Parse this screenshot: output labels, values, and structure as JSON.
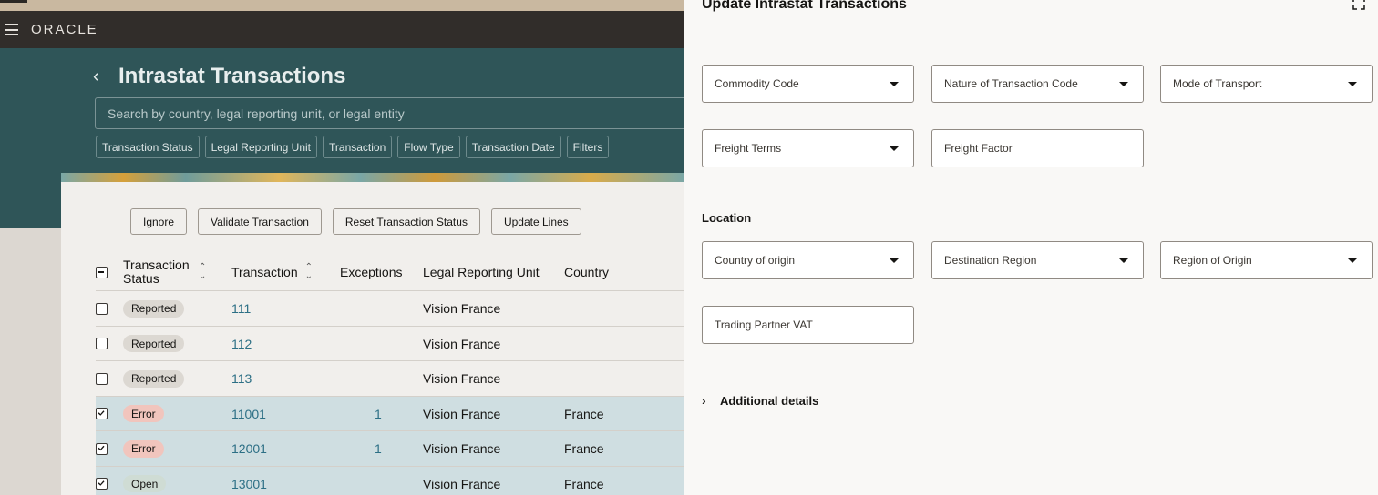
{
  "header": {
    "logo": "ORACLE"
  },
  "page": {
    "title": "Intrastat Transactions",
    "search_placeholder": "Search by country, legal reporting unit, or legal entity"
  },
  "filters": [
    "Transaction Status",
    "Legal Reporting Unit",
    "Transaction",
    "Flow Type",
    "Transaction Date",
    "Filters"
  ],
  "actions": [
    "Ignore",
    "Validate Transaction",
    "Reset Transaction Status",
    "Update Lines"
  ],
  "table": {
    "columns": [
      "Transaction Status",
      "Transaction",
      "Exceptions",
      "Legal Reporting Unit",
      "Country"
    ],
    "rows": [
      {
        "selected": false,
        "status": "Reported",
        "status_kind": "rep",
        "transaction": "111",
        "exceptions": "",
        "lru": "Vision France",
        "country": ""
      },
      {
        "selected": false,
        "status": "Reported",
        "status_kind": "rep",
        "transaction": "112",
        "exceptions": "",
        "lru": "Vision France",
        "country": ""
      },
      {
        "selected": false,
        "status": "Reported",
        "status_kind": "rep",
        "transaction": "113",
        "exceptions": "",
        "lru": "Vision France",
        "country": ""
      },
      {
        "selected": true,
        "status": "Error",
        "status_kind": "err",
        "transaction": "11001",
        "exceptions": "1",
        "lru": "Vision France",
        "country": "France"
      },
      {
        "selected": true,
        "status": "Error",
        "status_kind": "err",
        "transaction": "12001",
        "exceptions": "1",
        "lru": "Vision France",
        "country": "France"
      },
      {
        "selected": true,
        "status": "Open",
        "status_kind": "open",
        "transaction": "13001",
        "exceptions": "",
        "lru": "Vision France",
        "country": "France"
      }
    ]
  },
  "drawer": {
    "title": "Update Intrastat Transactions",
    "fields": {
      "commodity_code": "Commodity Code",
      "nature_of_transaction_code": "Nature of Transaction Code",
      "mode_of_transport": "Mode of Transport",
      "freight_terms": "Freight Terms",
      "freight_factor": "Freight Factor",
      "country_of_origin": "Country of origin",
      "destination_region": "Destination Region",
      "region_of_origin": "Region of Origin",
      "trading_partner_vat": "Trading Partner VAT"
    },
    "location_label": "Location",
    "additional_details": "Additional details"
  },
  "colors": {
    "hero": "#2f5558",
    "header": "#312d2a",
    "link": "#2c6f85",
    "selected_row": "#cfdee1"
  }
}
